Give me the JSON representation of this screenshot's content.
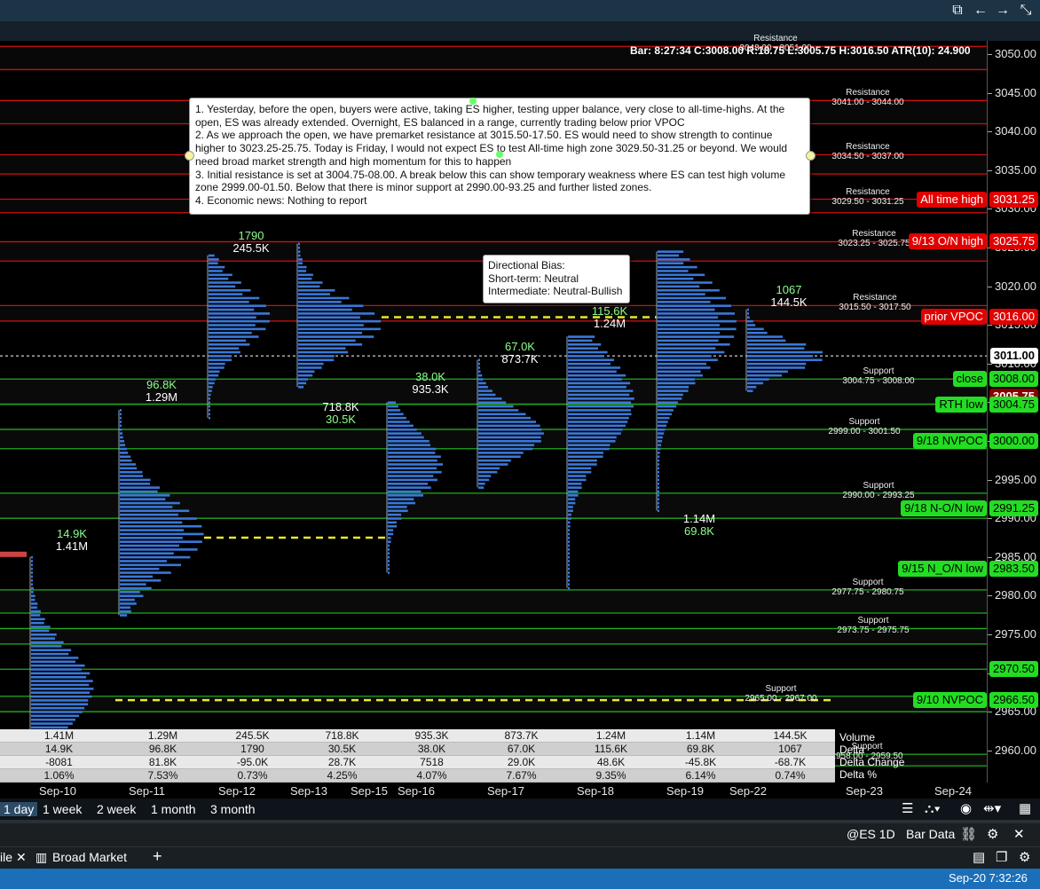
{
  "window": {
    "controls": [
      "popout-icon",
      "back-arrow-icon",
      "forward-arrow-icon",
      "collapse-icon"
    ]
  },
  "header_status": "Bar: 8:27:34 C:3008.00  R:18.75 L:3005.75  H:3016.50  ATR(10): 24.900",
  "note": {
    "lines": [
      "1. Yesterday, before the open, buyers were active, taking ES higher, testing upper balance, very close to all-time-highs.  At the open, ES was already extended.  Overnight, ES balanced in a range, currently trading below prior VPOC",
      "2. As we approach the open, we have premarket resistance at 3015.50-17.50.  ES would need to show strength to continue higher to 3023.25-25.75.  Today is Friday, I would not expect ES to test All-time high zone 3029.50-31.25 or beyond.  We would need broad market strength and high momentum for this to happen",
      "3. Initial resistance is set at 3004.75-08.00.  A break below this can show temporary weakness where ES can test high volume zone 2999.00-01.50.  Below that there is minor support at 2990.00-93.25 and further listed zones.",
      "4.  Economic news:  Nothing to report"
    ]
  },
  "bias": {
    "title": "Directional Bias:",
    "short": "Short-term: Neutral",
    "inter": "Intermediate: Neutral-Bullish"
  },
  "y_axis": {
    "ticks": [
      "3050.00",
      "3045.00",
      "3040.00",
      "3035.00",
      "3030.00",
      "3025.00",
      "3020.00",
      "3015.00",
      "3010.00",
      "3005.00",
      "3000.00",
      "2995.00",
      "2990.00",
      "2985.00",
      "2980.00",
      "2975.00",
      "2970.00",
      "2965.00",
      "2960.00"
    ]
  },
  "x_axis": {
    "ticks": [
      "Sep-10",
      "Sep-11",
      "Sep-12",
      "Sep-13",
      "Sep-15",
      "Sep-16",
      "Sep-17",
      "Sep-18",
      "Sep-19",
      "Sep-22",
      "Sep-23",
      "Sep-24"
    ]
  },
  "zones": [
    {
      "title": "Resistance",
      "range": "3048.00 - 3051.00"
    },
    {
      "title": "Resistance",
      "range": "3041.00 - 3044.00"
    },
    {
      "title": "Resistance",
      "range": "3034.50 - 3037.00"
    },
    {
      "title": "Resistance",
      "range": "3029.50 - 3031.25"
    },
    {
      "title": "Resistance",
      "range": "3023.25 - 3025.75"
    },
    {
      "title": "Resistance",
      "range": "3015.50 - 3017.50"
    },
    {
      "title": "Support",
      "range": "3004.75 - 3008.00"
    },
    {
      "title": "Support",
      "range": "2999.00 - 3001.50"
    },
    {
      "title": "Support",
      "range": "2990.00 - 2993.25"
    },
    {
      "title": "Support",
      "range": "2977.75 - 2980.75"
    },
    {
      "title": "Support",
      "range": "2973.75 - 2975.75"
    },
    {
      "title": "Support",
      "range": "2965.00 - 2967.00"
    },
    {
      "title": "Support",
      "range": "2958.00 - 2959.50"
    }
  ],
  "price_tags": [
    {
      "label": "All time high",
      "price": "3031.25",
      "style": "red"
    },
    {
      "label": "9/13 O/N high",
      "price": "3025.75",
      "style": "red"
    },
    {
      "label": "prior VPOC",
      "price": "3016.00",
      "style": "red"
    },
    {
      "label": "",
      "price": "3011.00",
      "style": "white"
    },
    {
      "label": "close",
      "price": "3008.00",
      "style": "green"
    },
    {
      "label": "",
      "price": "3005.75",
      "style": "maroon"
    },
    {
      "label": "RTH low",
      "price": "3004.75",
      "style": "green"
    },
    {
      "label": "9/18 NVPOC",
      "price": "3000.00",
      "style": "green"
    },
    {
      "label": "9/18 N-O/N low",
      "price": "2991.25",
      "style": "green"
    },
    {
      "label": "9/15 N_O/N low",
      "price": "2983.50",
      "style": "green"
    },
    {
      "label": "",
      "price": "2970.50",
      "style": "green"
    },
    {
      "label": "9/10 NVPOC",
      "price": "2966.50",
      "style": "green"
    }
  ],
  "profile_labels": [
    {
      "delta": "14.9K",
      "volume": "1.41M"
    },
    {
      "delta": "96.8K",
      "volume": "1.29M"
    },
    {
      "delta": "1790",
      "volume": "245.5K"
    },
    {
      "delta": "30.5K",
      "volume": "718.8K"
    },
    {
      "delta": "38.0K",
      "volume": "935.3K"
    },
    {
      "delta": "67.0K",
      "volume": "873.7K"
    },
    {
      "delta": "115.6K",
      "volume": "1.24M"
    },
    {
      "delta": "69.8K",
      "volume": "1.14M"
    },
    {
      "delta": "1067",
      "volume": "144.5K"
    }
  ],
  "stats": {
    "labels": [
      "Volume",
      "Delta",
      "Delta Change",
      "Delta %"
    ],
    "columns": [
      [
        "1.41M",
        "14.9K",
        "-8081",
        "1.06%"
      ],
      [
        "1.29M",
        "96.8K",
        "81.8K",
        "7.53%"
      ],
      [
        "245.5K",
        "1790",
        "-95.0K",
        "0.73%"
      ],
      [
        "718.8K",
        "30.5K",
        "28.7K",
        "4.25%"
      ],
      [
        "935.3K",
        "38.0K",
        "7518",
        "4.07%"
      ],
      [
        "873.7K",
        "67.0K",
        "29.0K",
        "7.67%"
      ],
      [
        "1.24M",
        "115.6K",
        "48.6K",
        "9.35%"
      ],
      [
        "1.14M",
        "69.8K",
        "-45.8K",
        "6.14%"
      ],
      [
        "144.5K",
        "1067",
        "-68.7K",
        "0.74%"
      ]
    ]
  },
  "range_buttons": [
    "1 day",
    "1 week",
    "2 week",
    "1 month",
    "3 month"
  ],
  "active_range": "1 day",
  "symbol": "@ES 1D",
  "bar_data_label": "Bar Data",
  "tabs": {
    "partial": "ile",
    "main": "Broad Market",
    "add": "+"
  },
  "clock": "Sep-20 7:32:26",
  "colors": {
    "resistance": "#cc1111",
    "support": "#1faa1f",
    "profile": "#3a78d8",
    "vpoc": "#e8e830"
  }
}
